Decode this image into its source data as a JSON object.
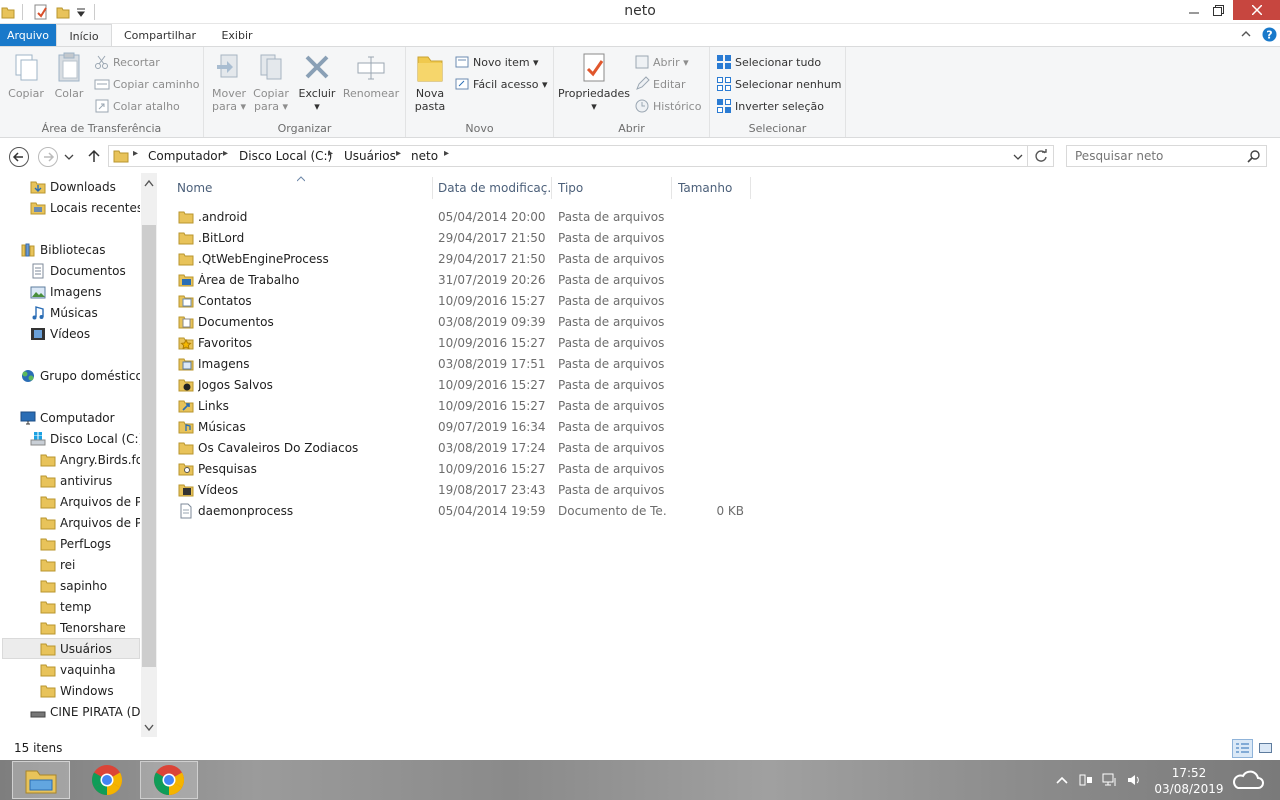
{
  "window": {
    "title": "neto"
  },
  "ribbon_tabs": [
    "Arquivo",
    "Início",
    "Compartilhar",
    "Exibir"
  ],
  "ribbon": {
    "clipboard": {
      "label": "Área de Transferência",
      "copy": "Copiar",
      "paste": "Colar",
      "cut": "Recortar",
      "copy_path": "Copiar caminho",
      "paste_shortcut": "Colar atalho"
    },
    "organize": {
      "label": "Organizar",
      "move_to": "Mover",
      "move_to2": "para",
      "copy_to": "Copiar",
      "copy_to2": "para",
      "delete": "Excluir",
      "rename": "Renomear"
    },
    "new": {
      "label": "Novo",
      "new_folder": "Nova",
      "new_folder2": "pasta",
      "new_item": "Novo item",
      "easy_access": "Fácil acesso"
    },
    "open": {
      "label": "Abrir",
      "properties": "Propriedades",
      "open": "Abrir",
      "edit": "Editar",
      "history": "Histórico"
    },
    "select": {
      "label": "Selecionar",
      "select_all": "Selecionar tudo",
      "select_none": "Selecionar nenhum",
      "invert": "Inverter seleção"
    }
  },
  "address": {
    "crumbs": [
      "Computador",
      "Disco Local (C:)",
      "Usuários",
      "neto"
    ]
  },
  "search": {
    "placeholder": "Pesquisar neto"
  },
  "nav": {
    "downloads": "Downloads",
    "recent": "Locais recentes",
    "libraries": "Bibliotecas",
    "documents": "Documentos",
    "images": "Imagens",
    "music": "Músicas",
    "videos": "Vídeos",
    "homegroup": "Grupo doméstico",
    "computer": "Computador",
    "disk_c": "Disco Local (C:)",
    "folders": [
      "Angry.Birds.for",
      "antivirus",
      "Arquivos de Pr",
      "Arquivos de Pr",
      "PerfLogs",
      "rei",
      "sapinho",
      "temp",
      "Tenorshare",
      "Usuários",
      "vaquinha",
      "Windows"
    ],
    "disk_d": "CINE PIRATA (D:)"
  },
  "columns": {
    "name": "Nome",
    "date": "Data de modificaç...",
    "type": "Tipo",
    "size": "Tamanho"
  },
  "files": [
    {
      "name": ".android",
      "date": "05/04/2014 20:00",
      "type": "Pasta de arquivos",
      "size": "",
      "icon": "folder-icon"
    },
    {
      "name": ".BitLord",
      "date": "29/04/2017 21:50",
      "type": "Pasta de arquivos",
      "size": "",
      "icon": "folder-icon"
    },
    {
      "name": ".QtWebEngineProcess",
      "date": "29/04/2017 21:50",
      "type": "Pasta de arquivos",
      "size": "",
      "icon": "folder-icon"
    },
    {
      "name": "Área de Trabalho",
      "date": "31/07/2019 20:26",
      "type": "Pasta de arquivos",
      "size": "",
      "icon": "desktop-folder-icon"
    },
    {
      "name": "Contatos",
      "date": "10/09/2016 15:27",
      "type": "Pasta de arquivos",
      "size": "",
      "icon": "contacts-folder-icon"
    },
    {
      "name": "Documentos",
      "date": "03/08/2019 09:39",
      "type": "Pasta de arquivos",
      "size": "",
      "icon": "documents-folder-icon"
    },
    {
      "name": "Favoritos",
      "date": "10/09/2016 15:27",
      "type": "Pasta de arquivos",
      "size": "",
      "icon": "favorites-folder-icon"
    },
    {
      "name": "Imagens",
      "date": "03/08/2019 17:51",
      "type": "Pasta de arquivos",
      "size": "",
      "icon": "images-folder-icon"
    },
    {
      "name": "Jogos Salvos",
      "date": "10/09/2016 15:27",
      "type": "Pasta de arquivos",
      "size": "",
      "icon": "saved-games-folder-icon"
    },
    {
      "name": "Links",
      "date": "10/09/2016 15:27",
      "type": "Pasta de arquivos",
      "size": "",
      "icon": "links-folder-icon"
    },
    {
      "name": "Músicas",
      "date": "09/07/2019 16:34",
      "type": "Pasta de arquivos",
      "size": "",
      "icon": "music-folder-icon"
    },
    {
      "name": "Os Cavaleiros Do Zodiacos",
      "date": "03/08/2019 17:24",
      "type": "Pasta de arquivos",
      "size": "",
      "icon": "folder-icon"
    },
    {
      "name": "Pesquisas",
      "date": "10/09/2016 15:27",
      "type": "Pasta de arquivos",
      "size": "",
      "icon": "searches-folder-icon"
    },
    {
      "name": "Vídeos",
      "date": "19/08/2017 23:43",
      "type": "Pasta de arquivos",
      "size": "",
      "icon": "videos-folder-icon"
    },
    {
      "name": "daemonprocess",
      "date": "05/04/2014 19:59",
      "type": "Documento de Te...",
      "size": "0 KB",
      "icon": "text-file-icon"
    }
  ],
  "status": {
    "count": "15 itens"
  },
  "clock": {
    "time": "17:52",
    "date": "03/08/2019"
  },
  "colors": {
    "accent": "#1979ca",
    "folder": "#e8c35a",
    "close": "#c7463f"
  }
}
